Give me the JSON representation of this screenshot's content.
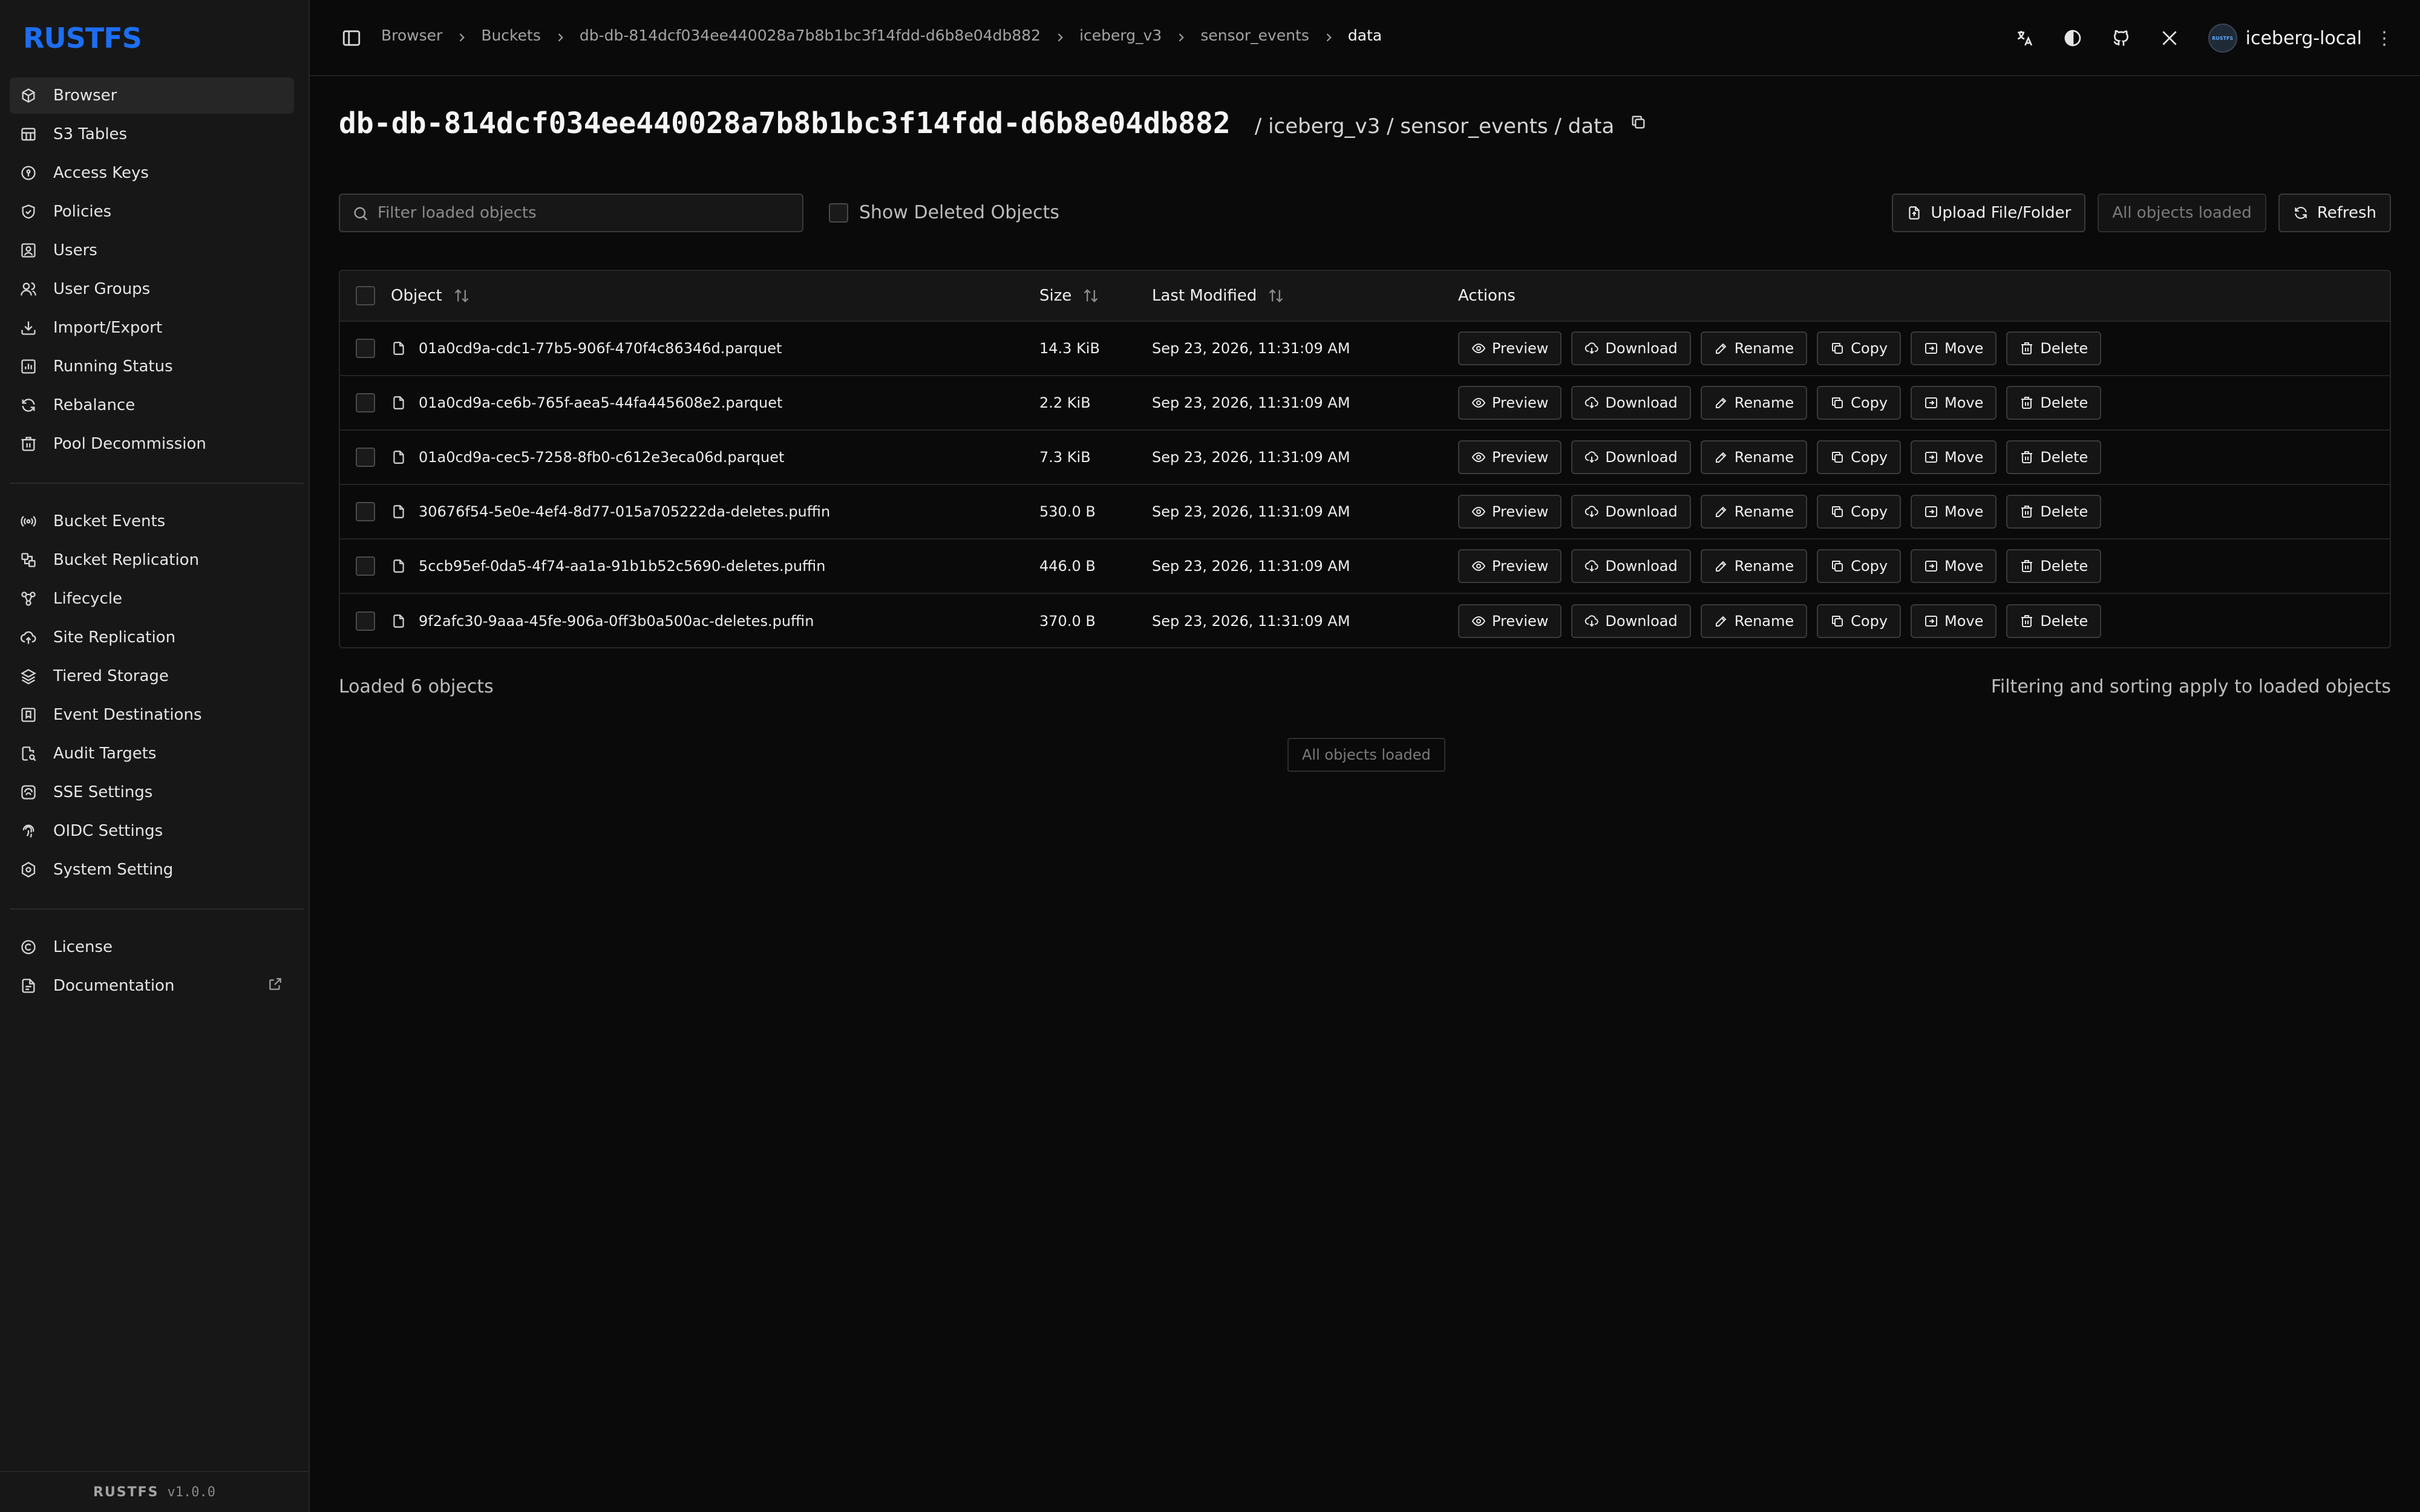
{
  "brand": {
    "logo_text": "RUSTFS",
    "footer_brand": "RUSTFS",
    "version": "v1.0.0"
  },
  "sidebar": {
    "group1": [
      {
        "label": "Browser",
        "icon": "cube-icon",
        "active": true
      },
      {
        "label": "S3 Tables",
        "icon": "table-icon"
      },
      {
        "label": "Access Keys",
        "icon": "key-icon"
      },
      {
        "label": "Policies",
        "icon": "shield-check-icon"
      },
      {
        "label": "Users",
        "icon": "user-icon"
      },
      {
        "label": "User Groups",
        "icon": "users-icon"
      },
      {
        "label": "Import/Export",
        "icon": "import-icon"
      },
      {
        "label": "Running Status",
        "icon": "chart-icon"
      },
      {
        "label": "Rebalance",
        "icon": "refresh-icon"
      },
      {
        "label": "Pool Decommission",
        "icon": "trash-icon"
      }
    ],
    "group2": [
      {
        "label": "Bucket Events",
        "icon": "broadcast-icon"
      },
      {
        "label": "Bucket Replication",
        "icon": "replication-icon"
      },
      {
        "label": "Lifecycle",
        "icon": "lifecycle-icon"
      },
      {
        "label": "Site Replication",
        "icon": "cloud-upload-icon"
      },
      {
        "label": "Tiered Storage",
        "icon": "layers-icon"
      },
      {
        "label": "Event Destinations",
        "icon": "bookmark-icon"
      },
      {
        "label": "Audit Targets",
        "icon": "audit-icon"
      },
      {
        "label": "SSE Settings",
        "icon": "sse-icon"
      },
      {
        "label": "OIDC Settings",
        "icon": "fingerprint-icon"
      },
      {
        "label": "System Setting",
        "icon": "gear-icon"
      }
    ],
    "group3": [
      {
        "label": "License",
        "icon": "copyright-icon"
      },
      {
        "label": "Documentation",
        "icon": "docs-icon"
      }
    ]
  },
  "breadcrumb": [
    "Browser",
    "Buckets",
    "db-db-814dcf034ee440028a7b8b1bc3f14fdd-d6b8e04db882",
    "iceberg_v3",
    "sensor_events",
    "data"
  ],
  "user": {
    "name": "iceberg-local",
    "avatar_text": "RUSTFS"
  },
  "header": {
    "title": "db-db-814dcf034ee440028a7b8b1bc3f14fdd-d6b8e04db882",
    "path": "/ iceberg_v3 / sensor_events / data"
  },
  "filter": {
    "placeholder": "Filter loaded objects",
    "show_deleted": "Show Deleted Objects"
  },
  "toolbar": {
    "upload": "Upload File/Folder",
    "all_loaded": "All objects loaded",
    "refresh": "Refresh"
  },
  "table": {
    "headers": {
      "object": "Object",
      "size": "Size",
      "modified": "Last Modified",
      "actions": "Actions"
    },
    "action_labels": [
      "Preview",
      "Download",
      "Rename",
      "Copy",
      "Move",
      "Delete"
    ],
    "rows": [
      {
        "name": "01a0cd9a-cdc1-77b5-906f-470f4c86346d.parquet",
        "size": "14.3 KiB",
        "modified": "Sep 23, 2026, 11:31:09 AM"
      },
      {
        "name": "01a0cd9a-ce6b-765f-aea5-44fa445608e2.parquet",
        "size": "2.2 KiB",
        "modified": "Sep 23, 2026, 11:31:09 AM"
      },
      {
        "name": "01a0cd9a-cec5-7258-8fb0-c612e3eca06d.parquet",
        "size": "7.3 KiB",
        "modified": "Sep 23, 2026, 11:31:09 AM"
      },
      {
        "name": "30676f54-5e0e-4ef4-8d77-015a705222da-deletes.puffin",
        "size": "530.0 B",
        "modified": "Sep 23, 2026, 11:31:09 AM"
      },
      {
        "name": "5ccb95ef-0da5-4f74-aa1a-91b1b52c5690-deletes.puffin",
        "size": "446.0 B",
        "modified": "Sep 23, 2026, 11:31:09 AM"
      },
      {
        "name": "9f2afc30-9aaa-45fe-906a-0ff3b0a500ac-deletes.puffin",
        "size": "370.0 B",
        "modified": "Sep 23, 2026, 11:31:09 AM"
      }
    ]
  },
  "footer": {
    "loaded_count": "Loaded 6 objects",
    "note": "Filtering and sorting apply to loaded objects",
    "all_loaded": "All objects loaded"
  },
  "colors": {
    "accent": "#1d6ef2",
    "bg": "#0a0a0a",
    "sidebar": "#171717"
  }
}
